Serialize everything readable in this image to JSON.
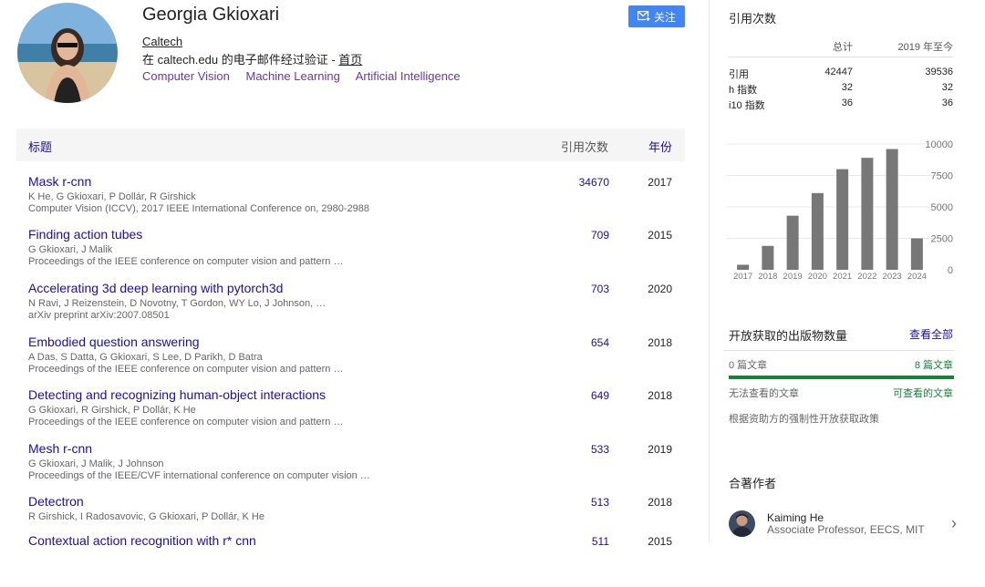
{
  "profile": {
    "name": "Georgia Gkioxari",
    "affiliation": "Caltech",
    "verified_text": "在 caltech.edu 的电子邮件经过验证 - ",
    "homepage_label": "首页",
    "interests": [
      "Computer Vision",
      "Machine Learning",
      "Artificial Intelligence"
    ],
    "follow_label": "关注"
  },
  "table": {
    "col_title": "标题",
    "col_citations": "引用次数",
    "col_year": "年份",
    "rows": [
      {
        "title": "Mask r-cnn",
        "authors": "K He, G Gkioxari, P Dollár, R Girshick",
        "venue": "Computer Vision (ICCV), 2017 IEEE International Conference on, 2980-2988",
        "citations": "34670",
        "year": "2017"
      },
      {
        "title": "Finding action tubes",
        "authors": "G Gkioxari, J Malik",
        "venue": "Proceedings of the IEEE conference on computer vision and pattern …",
        "citations": "709",
        "year": "2015"
      },
      {
        "title": "Accelerating 3d deep learning with pytorch3d",
        "authors": "N Ravi, J Reizenstein, D Novotny, T Gordon, WY Lo, J Johnson, …",
        "venue": "arXiv preprint arXiv:2007.08501",
        "citations": "703",
        "year": "2020"
      },
      {
        "title": "Embodied question answering",
        "authors": "A Das, S Datta, G Gkioxari, S Lee, D Parikh, D Batra",
        "venue": "Proceedings of the IEEE conference on computer vision and pattern …",
        "citations": "654",
        "year": "2018"
      },
      {
        "title": "Detecting and recognizing human-object interactions",
        "authors": "G Gkioxari, R Girshick, P Dollár, K He",
        "venue": "Proceedings of the IEEE conference on computer vision and pattern …",
        "citations": "649",
        "year": "2018"
      },
      {
        "title": "Mesh r-cnn",
        "authors": "G Gkioxari, J Malik, J Johnson",
        "venue": "Proceedings of the IEEE/CVF international conference on computer vision …",
        "citations": "533",
        "year": "2019"
      },
      {
        "title": "Detectron",
        "authors": "R Girshick, I Radosavovic, G Gkioxari, P Dollár, K He",
        "venue": "",
        "citations": "513",
        "year": "2018"
      },
      {
        "title": "Contextual action recognition with r* cnn",
        "authors": "",
        "venue": "",
        "citations": "511",
        "year": "2015"
      }
    ]
  },
  "cited_by": {
    "title": "引用次数",
    "col_total": "总计",
    "col_since": "2019 年至今",
    "rows": [
      {
        "label": "引用",
        "total": "42447",
        "since": "39536"
      },
      {
        "label": "h 指数",
        "total": "32",
        "since": "32"
      },
      {
        "label": "i10 指数",
        "total": "36",
        "since": "36"
      }
    ]
  },
  "chart_data": {
    "type": "bar",
    "categories": [
      "2017",
      "2018",
      "2019",
      "2020",
      "2021",
      "2022",
      "2023",
      "2024"
    ],
    "values": [
      400,
      1900,
      4300,
      6100,
      8000,
      8900,
      9600,
      2500
    ],
    "ylim": [
      0,
      10000
    ],
    "yticks": [
      "10000",
      "7500",
      "5000",
      "2500",
      "0"
    ],
    "bar_color": "#777777"
  },
  "open_access": {
    "title": "开放获取的出版物数量",
    "view_all": "查看全部",
    "left_count": "0 篇文章",
    "right_count": "8 篇文章",
    "left_label": "无法查看的文章",
    "right_label": "可查看的文章",
    "policy": "根据资助方的强制性开放获取政策",
    "available_fraction": 1.0
  },
  "coauthors": {
    "title": "合著作者",
    "items": [
      {
        "name": "Kaiming He",
        "position": "Associate Professor, EECS, MIT"
      }
    ]
  },
  "colors": {
    "link": "#1a0dab",
    "interest": "#6a36a8",
    "follow_button": "#4285f4",
    "open_access": "#188038"
  }
}
